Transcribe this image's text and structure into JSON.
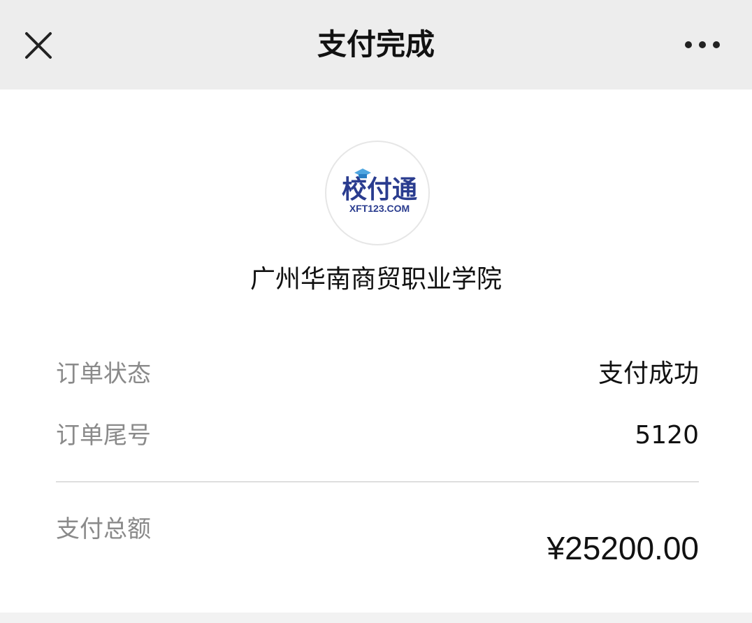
{
  "header": {
    "title": "支付完成",
    "close_icon": "close-icon",
    "more_icon": "more-dots-icon",
    "background": "#ededed"
  },
  "merchant": {
    "logo_text": "校付通",
    "logo_subtext": "XFT123.COM",
    "logo_accent": "#2a3c8f",
    "name": "广州华南商贸职业学院"
  },
  "order": {
    "status_label": "订单状态",
    "status_value": "支付成功",
    "tail_label": "订单尾号",
    "tail_value": "5120",
    "total_label": "支付总额",
    "total_value": "¥25200.00"
  }
}
